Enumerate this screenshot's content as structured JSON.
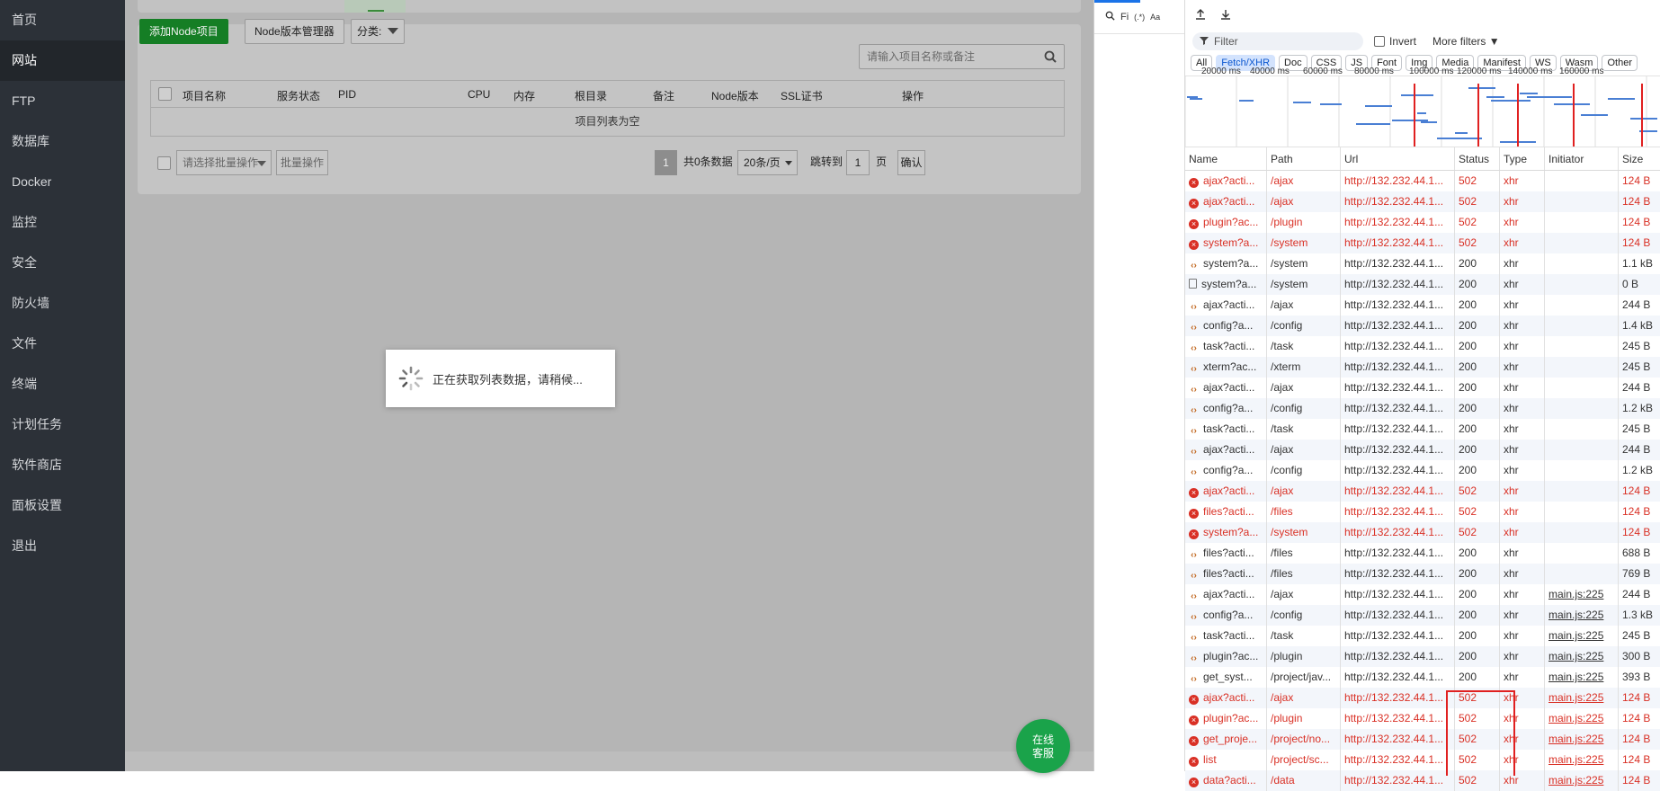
{
  "sidebar": {
    "items": [
      {
        "label": "首页",
        "active": false
      },
      {
        "label": "网站",
        "active": true
      },
      {
        "label": "FTP",
        "active": false
      },
      {
        "label": "数据库",
        "active": false
      },
      {
        "label": "Docker",
        "active": false
      },
      {
        "label": "监控",
        "active": false
      },
      {
        "label": "安全",
        "active": false
      },
      {
        "label": "防火墙",
        "active": false
      },
      {
        "label": "文件",
        "active": false
      },
      {
        "label": "终端",
        "active": false
      },
      {
        "label": "计划任务",
        "active": false
      },
      {
        "label": "软件商店",
        "active": false
      },
      {
        "label": "面板设置",
        "active": false
      },
      {
        "label": "退出",
        "active": false
      }
    ]
  },
  "toolbar": {
    "add_label": "添加Node项目",
    "version_manager_label": "Node版本管理器",
    "category_label": "分类:",
    "search_placeholder": "请输入项目名称或备注"
  },
  "table": {
    "headers": [
      "项目名称",
      "服务状态",
      "PID",
      "CPU",
      "内存",
      "根目录",
      "备注",
      "Node版本",
      "SSL证书",
      "操作"
    ],
    "empty_text": "项目列表为空"
  },
  "pagination": {
    "batch_placeholder": "请选择批量操作",
    "batch_button": "批量操作",
    "current_page": "1",
    "total_text": "共0条数据",
    "per_page": "20条/页",
    "jump_label": "跳转到",
    "jump_value": "1",
    "page_unit": "页",
    "confirm_label": "确认"
  },
  "loading_text": "正在获取列表数据，请稍候...",
  "online_service": {
    "line1": "在线",
    "line2": "客服"
  },
  "devtools": {
    "filter_placeholder": "Filter",
    "invert_label": "Invert",
    "more_filters_label": "More filters",
    "type_chips": [
      "All",
      "Fetch/XHR",
      "Doc",
      "CSS",
      "JS",
      "Font",
      "Img",
      "Media",
      "Manifest",
      "WS",
      "Wasm",
      "Other"
    ],
    "active_chip": "Fetch/XHR",
    "ruler": [
      "20000 ms",
      "40000 ms",
      "60000 ms",
      "80000 ms",
      "100000 ms",
      "120000 ms",
      "140000 ms",
      "160000 ms"
    ],
    "left_search": "Fi",
    "columns": [
      "Name",
      "Path",
      "Url",
      "Status",
      "Type",
      "Initiator",
      "Size"
    ],
    "rows": [
      {
        "name": "ajax?acti...",
        "path": "/ajax",
        "url": "http://132.232.44.1...",
        "status": "502",
        "type": "xhr",
        "initiator": "",
        "size": "124 B",
        "err": true
      },
      {
        "name": "ajax?acti...",
        "path": "/ajax",
        "url": "http://132.232.44.1...",
        "status": "502",
        "type": "xhr",
        "initiator": "",
        "size": "124 B",
        "err": true
      },
      {
        "name": "plugin?ac...",
        "path": "/plugin",
        "url": "http://132.232.44.1...",
        "status": "502",
        "type": "xhr",
        "initiator": "",
        "size": "124 B",
        "err": true
      },
      {
        "name": "system?a...",
        "path": "/system",
        "url": "http://132.232.44.1...",
        "status": "502",
        "type": "xhr",
        "initiator": "",
        "size": "124 B",
        "err": true
      },
      {
        "name": "system?a...",
        "path": "/system",
        "url": "http://132.232.44.1...",
        "status": "200",
        "type": "xhr",
        "initiator": "",
        "size": "1.1 kB",
        "err": false
      },
      {
        "name": "system?a...",
        "path": "/system",
        "url": "http://132.232.44.1...",
        "status": "200",
        "type": "xhr",
        "initiator": "",
        "size": "0 B",
        "err": false,
        "doc": true
      },
      {
        "name": "ajax?acti...",
        "path": "/ajax",
        "url": "http://132.232.44.1...",
        "status": "200",
        "type": "xhr",
        "initiator": "",
        "size": "244 B",
        "err": false
      },
      {
        "name": "config?a...",
        "path": "/config",
        "url": "http://132.232.44.1...",
        "status": "200",
        "type": "xhr",
        "initiator": "",
        "size": "1.4 kB",
        "err": false
      },
      {
        "name": "task?acti...",
        "path": "/task",
        "url": "http://132.232.44.1...",
        "status": "200",
        "type": "xhr",
        "initiator": "",
        "size": "245 B",
        "err": false
      },
      {
        "name": "xterm?ac...",
        "path": "/xterm",
        "url": "http://132.232.44.1...",
        "status": "200",
        "type": "xhr",
        "initiator": "",
        "size": "245 B",
        "err": false
      },
      {
        "name": "ajax?acti...",
        "path": "/ajax",
        "url": "http://132.232.44.1...",
        "status": "200",
        "type": "xhr",
        "initiator": "",
        "size": "244 B",
        "err": false
      },
      {
        "name": "config?a...",
        "path": "/config",
        "url": "http://132.232.44.1...",
        "status": "200",
        "type": "xhr",
        "initiator": "",
        "size": "1.2 kB",
        "err": false
      },
      {
        "name": "task?acti...",
        "path": "/task",
        "url": "http://132.232.44.1...",
        "status": "200",
        "type": "xhr",
        "initiator": "",
        "size": "245 B",
        "err": false
      },
      {
        "name": "ajax?acti...",
        "path": "/ajax",
        "url": "http://132.232.44.1...",
        "status": "200",
        "type": "xhr",
        "initiator": "",
        "size": "244 B",
        "err": false
      },
      {
        "name": "config?a...",
        "path": "/config",
        "url": "http://132.232.44.1...",
        "status": "200",
        "type": "xhr",
        "initiator": "",
        "size": "1.2 kB",
        "err": false
      },
      {
        "name": "ajax?acti...",
        "path": "/ajax",
        "url": "http://132.232.44.1...",
        "status": "502",
        "type": "xhr",
        "initiator": "",
        "size": "124 B",
        "err": true
      },
      {
        "name": "files?acti...",
        "path": "/files",
        "url": "http://132.232.44.1...",
        "status": "502",
        "type": "xhr",
        "initiator": "",
        "size": "124 B",
        "err": true
      },
      {
        "name": "system?a...",
        "path": "/system",
        "url": "http://132.232.44.1...",
        "status": "502",
        "type": "xhr",
        "initiator": "",
        "size": "124 B",
        "err": true
      },
      {
        "name": "files?acti...",
        "path": "/files",
        "url": "http://132.232.44.1...",
        "status": "200",
        "type": "xhr",
        "initiator": "",
        "size": "688 B",
        "err": false
      },
      {
        "name": "files?acti...",
        "path": "/files",
        "url": "http://132.232.44.1...",
        "status": "200",
        "type": "xhr",
        "initiator": "",
        "size": "769 B",
        "err": false
      },
      {
        "name": "ajax?acti...",
        "path": "/ajax",
        "url": "http://132.232.44.1...",
        "status": "200",
        "type": "xhr",
        "initiator": "main.js:225",
        "size": "244 B",
        "err": false
      },
      {
        "name": "config?a...",
        "path": "/config",
        "url": "http://132.232.44.1...",
        "status": "200",
        "type": "xhr",
        "initiator": "main.js:225",
        "size": "1.3 kB",
        "err": false
      },
      {
        "name": "task?acti...",
        "path": "/task",
        "url": "http://132.232.44.1...",
        "status": "200",
        "type": "xhr",
        "initiator": "main.js:225",
        "size": "245 B",
        "err": false
      },
      {
        "name": "plugin?ac...",
        "path": "/plugin",
        "url": "http://132.232.44.1...",
        "status": "200",
        "type": "xhr",
        "initiator": "main.js:225",
        "size": "300 B",
        "err": false
      },
      {
        "name": "get_syst...",
        "path": "/project/jav...",
        "url": "http://132.232.44.1...",
        "status": "200",
        "type": "xhr",
        "initiator": "main.js:225",
        "size": "393 B",
        "err": false
      },
      {
        "name": "ajax?acti...",
        "path": "/ajax",
        "url": "http://132.232.44.1...",
        "status": "502",
        "type": "xhr",
        "initiator": "main.js:225",
        "size": "124 B",
        "err": true
      },
      {
        "name": "plugin?ac...",
        "path": "/plugin",
        "url": "http://132.232.44.1...",
        "status": "502",
        "type": "xhr",
        "initiator": "main.js:225",
        "size": "124 B",
        "err": true
      },
      {
        "name": "get_proje...",
        "path": "/project/no...",
        "url": "http://132.232.44.1...",
        "status": "502",
        "type": "xhr",
        "initiator": "main.js:225",
        "size": "124 B",
        "err": true
      },
      {
        "name": "list",
        "path": "/project/sc...",
        "url": "http://132.232.44.1...",
        "status": "502",
        "type": "xhr",
        "initiator": "main.js:225",
        "size": "124 B",
        "err": true
      },
      {
        "name": "data?acti...",
        "path": "/data",
        "url": "http://132.232.44.1...",
        "status": "502",
        "type": "xhr",
        "initiator": "main.js:225",
        "size": "124 B",
        "err": true
      }
    ]
  }
}
